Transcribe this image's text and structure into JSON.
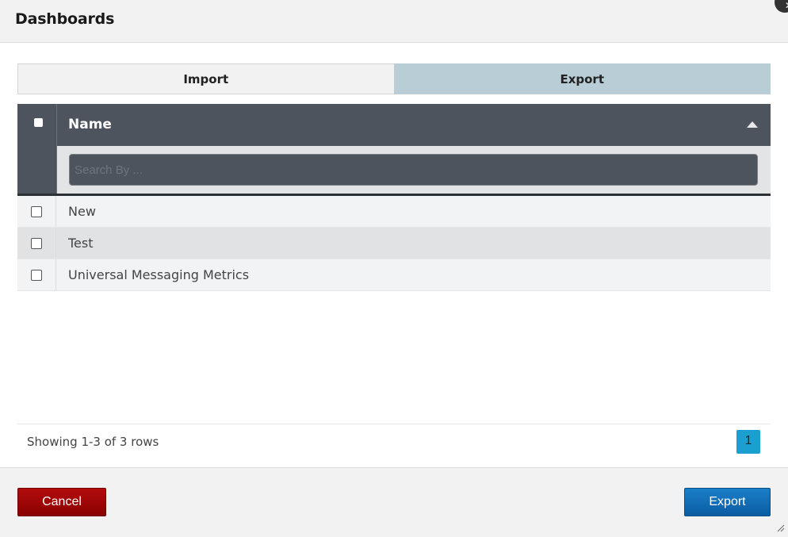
{
  "dialog": {
    "title": "Dashboards",
    "close_icon": "close-icon"
  },
  "tabs": [
    {
      "label": "Import",
      "active": false
    },
    {
      "label": "Export",
      "active": true
    }
  ],
  "grid": {
    "column_name": "Name",
    "search_placeholder": "Search By ...",
    "rows": [
      {
        "name": "New"
      },
      {
        "name": "Test"
      },
      {
        "name": "Universal Messaging Metrics"
      }
    ]
  },
  "pager": {
    "showing": "Showing 1-3 of 3 rows",
    "page": "1"
  },
  "footer": {
    "cancel_label": "Cancel",
    "export_label": "Export"
  },
  "colors": {
    "header_bg": "#4d545d",
    "active_tab": "#b8cdd6",
    "cancel": "#9b0000",
    "export": "#1270b8",
    "page_active": "#1a9fd0"
  }
}
